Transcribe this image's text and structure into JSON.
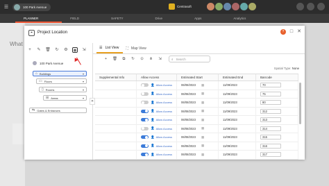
{
  "topbar": {
    "breadcrumb": "100 Park Avenue",
    "org_name": "Centrasoft"
  },
  "nav": {
    "items": [
      "PLANNER",
      "FIELD",
      "SAFETY",
      "Drive",
      "Apps",
      "Analytics"
    ]
  },
  "background": {
    "heading": "What"
  },
  "modal": {
    "title": "Project Location",
    "help": "?",
    "maximize": "□",
    "close": "✕"
  },
  "left_panel": {
    "toolbar_icons": [
      "add-icon",
      "edit-icon",
      "delete-icon",
      "refresh-icon",
      "settings-icon",
      "target-icon",
      "export-icon"
    ],
    "root": "100 Park Avenue",
    "nodes": [
      {
        "label": "Buildings"
      },
      {
        "label": "Floors"
      },
      {
        "label": "Rooms"
      },
      {
        "label": "Areas"
      },
      {
        "label": "Gates & Entrances"
      }
    ]
  },
  "tabs": {
    "list_view": "List View",
    "map_view": "Map View"
  },
  "right_toolbar": {
    "icons": [
      "add-icon",
      "delete-icon",
      "copy-icon",
      "refresh-icon",
      "pin-icon",
      "hierarchy-icon",
      "export-icon"
    ]
  },
  "search": {
    "placeholder": "Search"
  },
  "spatial": {
    "label": "Spatial Type:",
    "value": "None"
  },
  "grid": {
    "columns": [
      "Supplemental Info",
      "Allow Access",
      "Estimated Start",
      "Estimated End",
      "Barcode"
    ],
    "rows": [
      {
        "toggle": false,
        "access": "Allow Access",
        "start": "06/08/2023",
        "end": "11/09/2023",
        "barcode": "70"
      },
      {
        "toggle": false,
        "access": "Allow Access",
        "start": "06/08/2023",
        "end": "11/09/2023",
        "barcode": "75"
      },
      {
        "toggle": false,
        "access": "Allow Access",
        "start": "06/08/2023",
        "end": "11/09/2023",
        "barcode": "80"
      },
      {
        "toggle": true,
        "access": "Allow Access",
        "start": "06/08/2023",
        "end": "11/09/2023",
        "barcode": "312"
      },
      {
        "toggle": true,
        "access": "Allow Access",
        "start": "06/08/2023",
        "end": "11/09/2023",
        "barcode": "313"
      },
      {
        "toggle": false,
        "access": "Allow Access",
        "start": "06/08/2023",
        "end": "11/09/2023",
        "barcode": "314"
      },
      {
        "toggle": true,
        "access": "Allow Access",
        "start": "06/08/2023",
        "end": "11/09/2023",
        "barcode": "315"
      },
      {
        "toggle": true,
        "access": "Allow Access",
        "start": "06/08/2023",
        "end": "11/09/2023",
        "barcode": "316"
      },
      {
        "toggle": true,
        "access": "Allow Access",
        "start": "06/08/2023",
        "end": "11/09/2023",
        "barcode": "317"
      }
    ]
  },
  "colors": {
    "accent": "#e8602c",
    "link": "#3b6cc9",
    "tab_underline": "#e8a020"
  }
}
